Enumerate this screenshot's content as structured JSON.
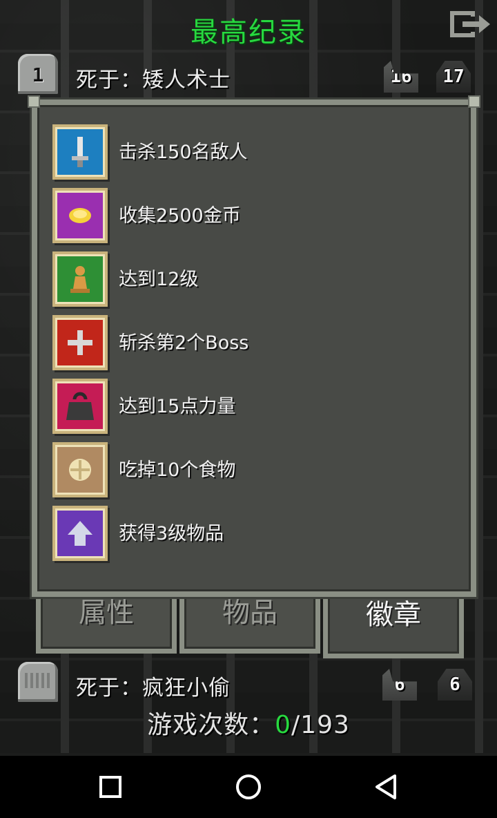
{
  "title": "最高纪录",
  "records": {
    "top": {
      "rank": "1",
      "death_text": "死于：矮人术士",
      "level": "16",
      "depth": "17"
    },
    "bottom": {
      "death_text": "死于：疯狂小偷",
      "level": "6",
      "depth": "6"
    }
  },
  "badges": [
    {
      "label": "击杀150名敌人",
      "icon": "sword-icon",
      "color": "#1d7fc0"
    },
    {
      "label": "收集2500金币",
      "icon": "gold-icon",
      "color": "#9a2fb0"
    },
    {
      "label": "达到12级",
      "icon": "pawn-icon",
      "color": "#2e8f35"
    },
    {
      "label": "斩杀第2个Boss",
      "icon": "cross-icon",
      "color": "#c1261a"
    },
    {
      "label": "达到15点力量",
      "icon": "weight-icon",
      "color": "#c51c55"
    },
    {
      "label": "吃掉10个食物",
      "icon": "food-icon",
      "color": "#b08a62"
    },
    {
      "label": "获得3级物品",
      "icon": "arrow-up-icon",
      "color": "#6a39b5"
    }
  ],
  "tabs": [
    {
      "label": "属性",
      "active": false
    },
    {
      "label": "物品",
      "active": false
    },
    {
      "label": "徽章",
      "active": true
    }
  ],
  "games_played": {
    "label": "游戏次数：",
    "won": "0",
    "total": "/193"
  },
  "accent": "#27d93f"
}
